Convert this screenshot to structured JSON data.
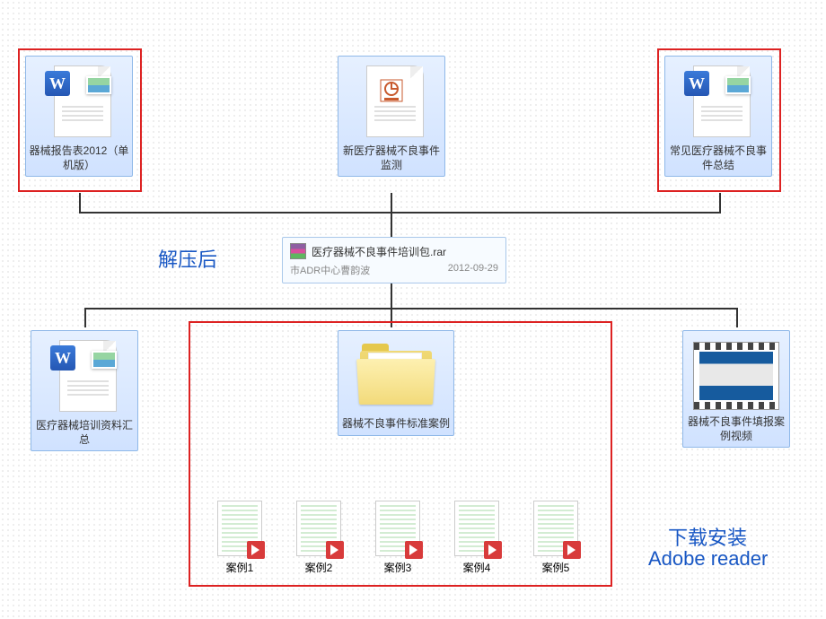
{
  "annotations": {
    "extract_label": "解压后",
    "download_label": "下载安装",
    "adobe_reader": "Adobe reader"
  },
  "top_row": [
    {
      "label": "器械报告表2012（单机版）",
      "type": "word"
    },
    {
      "label": "新医疗器械不良事件监测",
      "type": "ppt"
    },
    {
      "label": "常见医疗器械不良事件总结",
      "type": "word"
    }
  ],
  "archive": {
    "name": "医疗器械不良事件培训包.rar",
    "author": "市ADR中心曹韵波",
    "date": "2012-09-29"
  },
  "bottom_row": [
    {
      "label": "医疗器械培训资料汇总",
      "type": "word"
    },
    {
      "label": "器械不良事件标准案例",
      "type": "folder"
    },
    {
      "label": "器械不良事件填报案例视频",
      "type": "video"
    }
  ],
  "cases": [
    {
      "label": "案例1"
    },
    {
      "label": "案例2"
    },
    {
      "label": "案例3"
    },
    {
      "label": "案例4"
    },
    {
      "label": "案例5"
    }
  ]
}
